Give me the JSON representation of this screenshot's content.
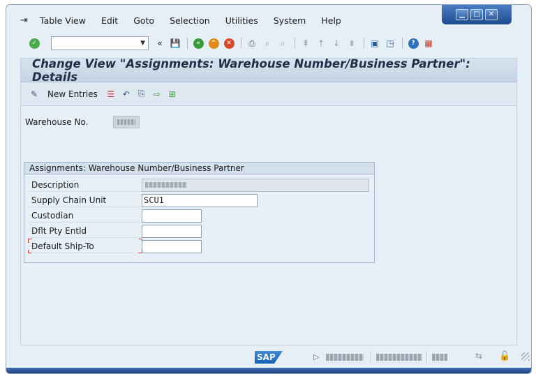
{
  "menubar": {
    "items": [
      "Table View",
      "Edit",
      "Goto",
      "Selection",
      "Utilities",
      "System",
      "Help"
    ]
  },
  "toolbar": {
    "command_field_value": ""
  },
  "screen": {
    "title": "Change View \"Assignments: Warehouse Number/Business Partner\": Details"
  },
  "app_toolbar": {
    "new_entries_label": "New Entries"
  },
  "warehouse": {
    "label": "Warehouse No."
  },
  "group": {
    "title": "Assignments: Warehouse Number/Business Partner",
    "fields": {
      "description_label": "Description",
      "supply_chain_unit_label": "Supply Chain Unit",
      "supply_chain_unit_value": "SCU1",
      "custodian_label": "Custodian",
      "custodian_value": "",
      "dflt_pty_label": "Dflt Pty Entld",
      "dflt_pty_value": "",
      "default_ship_to_label": "Default Ship-To",
      "default_ship_to_value": ""
    }
  },
  "statusbar": {
    "logo_text": "SAP"
  },
  "colors": {
    "frame_blue": "#1d3f7c",
    "panel_bg": "#e8f0f7",
    "title_text": "#1f2f45"
  }
}
